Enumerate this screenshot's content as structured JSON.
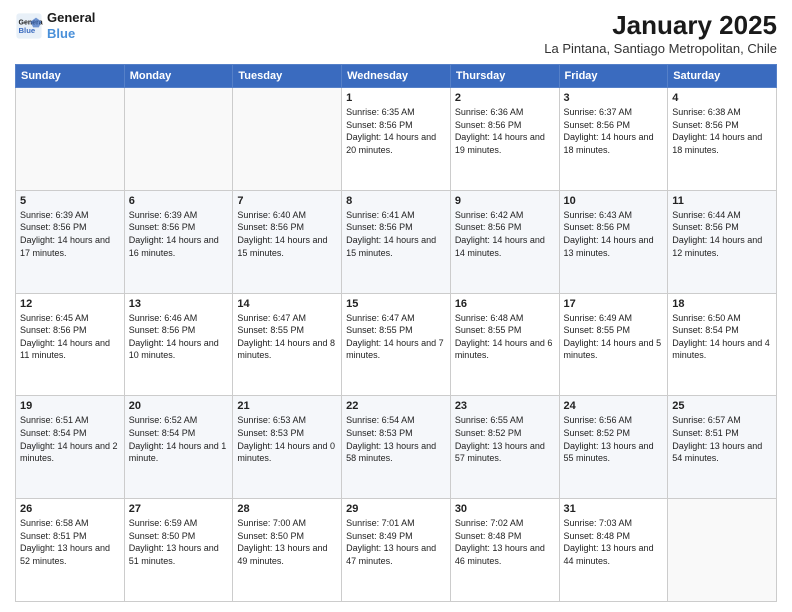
{
  "header": {
    "logo_line1": "General",
    "logo_line2": "Blue",
    "title": "January 2025",
    "subtitle": "La Pintana, Santiago Metropolitan, Chile"
  },
  "days_of_week": [
    "Sunday",
    "Monday",
    "Tuesday",
    "Wednesday",
    "Thursday",
    "Friday",
    "Saturday"
  ],
  "weeks": [
    [
      {
        "day": "",
        "info": ""
      },
      {
        "day": "",
        "info": ""
      },
      {
        "day": "",
        "info": ""
      },
      {
        "day": "1",
        "info": "Sunrise: 6:35 AM\nSunset: 8:56 PM\nDaylight: 14 hours\nand 20 minutes."
      },
      {
        "day": "2",
        "info": "Sunrise: 6:36 AM\nSunset: 8:56 PM\nDaylight: 14 hours\nand 19 minutes."
      },
      {
        "day": "3",
        "info": "Sunrise: 6:37 AM\nSunset: 8:56 PM\nDaylight: 14 hours\nand 18 minutes."
      },
      {
        "day": "4",
        "info": "Sunrise: 6:38 AM\nSunset: 8:56 PM\nDaylight: 14 hours\nand 18 minutes."
      }
    ],
    [
      {
        "day": "5",
        "info": "Sunrise: 6:39 AM\nSunset: 8:56 PM\nDaylight: 14 hours\nand 17 minutes."
      },
      {
        "day": "6",
        "info": "Sunrise: 6:39 AM\nSunset: 8:56 PM\nDaylight: 14 hours\nand 16 minutes."
      },
      {
        "day": "7",
        "info": "Sunrise: 6:40 AM\nSunset: 8:56 PM\nDaylight: 14 hours\nand 15 minutes."
      },
      {
        "day": "8",
        "info": "Sunrise: 6:41 AM\nSunset: 8:56 PM\nDaylight: 14 hours\nand 15 minutes."
      },
      {
        "day": "9",
        "info": "Sunrise: 6:42 AM\nSunset: 8:56 PM\nDaylight: 14 hours\nand 14 minutes."
      },
      {
        "day": "10",
        "info": "Sunrise: 6:43 AM\nSunset: 8:56 PM\nDaylight: 14 hours\nand 13 minutes."
      },
      {
        "day": "11",
        "info": "Sunrise: 6:44 AM\nSunset: 8:56 PM\nDaylight: 14 hours\nand 12 minutes."
      }
    ],
    [
      {
        "day": "12",
        "info": "Sunrise: 6:45 AM\nSunset: 8:56 PM\nDaylight: 14 hours\nand 11 minutes."
      },
      {
        "day": "13",
        "info": "Sunrise: 6:46 AM\nSunset: 8:56 PM\nDaylight: 14 hours\nand 10 minutes."
      },
      {
        "day": "14",
        "info": "Sunrise: 6:47 AM\nSunset: 8:55 PM\nDaylight: 14 hours\nand 8 minutes."
      },
      {
        "day": "15",
        "info": "Sunrise: 6:47 AM\nSunset: 8:55 PM\nDaylight: 14 hours\nand 7 minutes."
      },
      {
        "day": "16",
        "info": "Sunrise: 6:48 AM\nSunset: 8:55 PM\nDaylight: 14 hours\nand 6 minutes."
      },
      {
        "day": "17",
        "info": "Sunrise: 6:49 AM\nSunset: 8:55 PM\nDaylight: 14 hours\nand 5 minutes."
      },
      {
        "day": "18",
        "info": "Sunrise: 6:50 AM\nSunset: 8:54 PM\nDaylight: 14 hours\nand 4 minutes."
      }
    ],
    [
      {
        "day": "19",
        "info": "Sunrise: 6:51 AM\nSunset: 8:54 PM\nDaylight: 14 hours\nand 2 minutes."
      },
      {
        "day": "20",
        "info": "Sunrise: 6:52 AM\nSunset: 8:54 PM\nDaylight: 14 hours\nand 1 minute."
      },
      {
        "day": "21",
        "info": "Sunrise: 6:53 AM\nSunset: 8:53 PM\nDaylight: 14 hours\nand 0 minutes."
      },
      {
        "day": "22",
        "info": "Sunrise: 6:54 AM\nSunset: 8:53 PM\nDaylight: 13 hours\nand 58 minutes."
      },
      {
        "day": "23",
        "info": "Sunrise: 6:55 AM\nSunset: 8:52 PM\nDaylight: 13 hours\nand 57 minutes."
      },
      {
        "day": "24",
        "info": "Sunrise: 6:56 AM\nSunset: 8:52 PM\nDaylight: 13 hours\nand 55 minutes."
      },
      {
        "day": "25",
        "info": "Sunrise: 6:57 AM\nSunset: 8:51 PM\nDaylight: 13 hours\nand 54 minutes."
      }
    ],
    [
      {
        "day": "26",
        "info": "Sunrise: 6:58 AM\nSunset: 8:51 PM\nDaylight: 13 hours\nand 52 minutes."
      },
      {
        "day": "27",
        "info": "Sunrise: 6:59 AM\nSunset: 8:50 PM\nDaylight: 13 hours\nand 51 minutes."
      },
      {
        "day": "28",
        "info": "Sunrise: 7:00 AM\nSunset: 8:50 PM\nDaylight: 13 hours\nand 49 minutes."
      },
      {
        "day": "29",
        "info": "Sunrise: 7:01 AM\nSunset: 8:49 PM\nDaylight: 13 hours\nand 47 minutes."
      },
      {
        "day": "30",
        "info": "Sunrise: 7:02 AM\nSunset: 8:48 PM\nDaylight: 13 hours\nand 46 minutes."
      },
      {
        "day": "31",
        "info": "Sunrise: 7:03 AM\nSunset: 8:48 PM\nDaylight: 13 hours\nand 44 minutes."
      },
      {
        "day": "",
        "info": ""
      }
    ]
  ]
}
